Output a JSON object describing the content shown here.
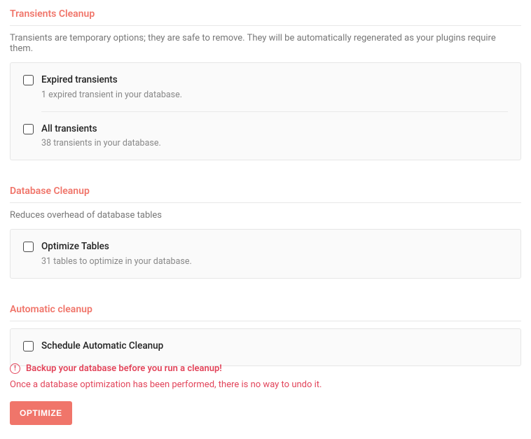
{
  "sections": {
    "transients": {
      "title": "Transients Cleanup",
      "desc": "Transients are temporary options; they are safe to remove. They will be automatically regenerated as your plugins require them.",
      "items": [
        {
          "label": "Expired transients",
          "sub": "1 expired transient in your database."
        },
        {
          "label": "All transients",
          "sub": "38 transients in your database."
        }
      ]
    },
    "database": {
      "title": "Database Cleanup",
      "desc": "Reduces overhead of database tables",
      "items": [
        {
          "label": "Optimize Tables",
          "sub": "31 tables to optimize in your database."
        }
      ]
    },
    "automatic": {
      "title": "Automatic cleanup",
      "items": [
        {
          "label": "Schedule Automatic Cleanup"
        }
      ]
    }
  },
  "alert": {
    "heading": "Backup your database before you run a cleanup!",
    "sub": "Once a database optimization has been performed, there is no way to undo it."
  },
  "button": {
    "optimize": "OPTIMIZE"
  }
}
